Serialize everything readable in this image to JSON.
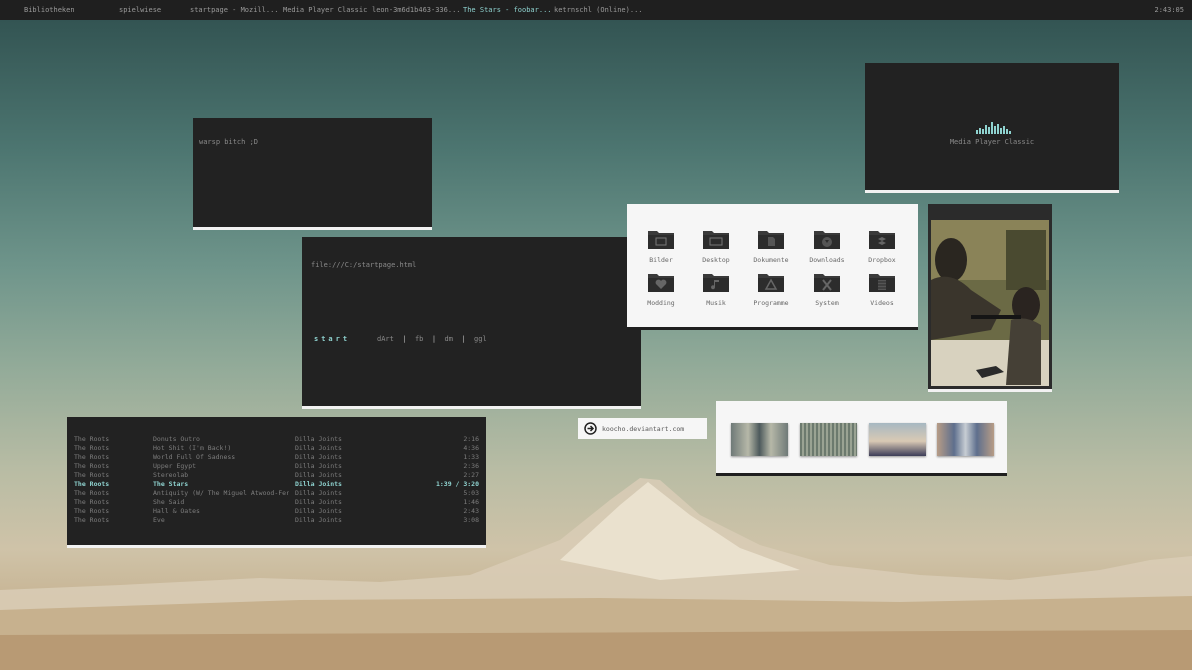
{
  "taskbar": {
    "items": [
      "Bibliotheken",
      "spielwiese",
      "startpage - Mozill...",
      "Media Player Classic",
      "leon-3m6d1b463-336...",
      "The Stars - foobar...",
      "ketrnschl (Online)..."
    ],
    "active_index": 5,
    "clock": "2:43:05"
  },
  "terminal": {
    "text": "warsp bitch ;D"
  },
  "mpc": {
    "label": "Media Player Classic"
  },
  "browser": {
    "url": "file:///C:/startpage.html",
    "start_label": "start",
    "links": [
      "dArt",
      "fb",
      "dm",
      "ggl"
    ],
    "separator": "|"
  },
  "folders": {
    "items": [
      {
        "label": "Bilder",
        "icon": "pictures-folder-icon"
      },
      {
        "label": "Desktop",
        "icon": "desktop-folder-icon"
      },
      {
        "label": "Dokumente",
        "icon": "documents-folder-icon"
      },
      {
        "label": "Downloads",
        "icon": "downloads-folder-icon"
      },
      {
        "label": "Dropbox",
        "icon": "dropbox-folder-icon"
      },
      {
        "label": "Modding",
        "icon": "heart-folder-icon"
      },
      {
        "label": "Musik",
        "icon": "music-folder-icon"
      },
      {
        "label": "Programme",
        "icon": "programs-folder-icon"
      },
      {
        "label": "System",
        "icon": "system-folder-icon"
      },
      {
        "label": "Videos",
        "icon": "videos-folder-icon"
      }
    ]
  },
  "playlist": {
    "rows": [
      {
        "artist": "The Roots",
        "title": "Donuts Outro",
        "album": "Dilla Joints",
        "time": "2:16",
        "playing": false
      },
      {
        "artist": "The Roots",
        "title": "Hot Shit (I'm Back!)",
        "album": "Dilla Joints",
        "time": "4:36",
        "playing": false
      },
      {
        "artist": "The Roots",
        "title": "World Full Of Sadness",
        "album": "Dilla Joints",
        "time": "1:33",
        "playing": false
      },
      {
        "artist": "The Roots",
        "title": "Upper Egypt",
        "album": "Dilla Joints",
        "time": "2:36",
        "playing": false
      },
      {
        "artist": "The Roots",
        "title": "Stereolab",
        "album": "Dilla Joints",
        "time": "2:27",
        "playing": false
      },
      {
        "artist": "The Roots",
        "title": "The Stars",
        "album": "Dilla Joints",
        "time": "1:39 / 3:20",
        "playing": true
      },
      {
        "artist": "The Roots",
        "title": "Antiquity (W/ The Miguel Atwood-Fer...",
        "album": "Dilla Joints",
        "time": "5:03",
        "playing": false
      },
      {
        "artist": "The Roots",
        "title": "She Said",
        "album": "Dilla Joints",
        "time": "1:46",
        "playing": false
      },
      {
        "artist": "The Roots",
        "title": "Hall & Oates",
        "album": "Dilla Joints",
        "time": "2:43",
        "playing": false
      },
      {
        "artist": "The Roots",
        "title": "Eve",
        "album": "Dilla Joints",
        "time": "3:08",
        "playing": false
      }
    ]
  },
  "deviantart": {
    "text": "koocho.deviantart.com",
    "icon": "arrow-circle-icon"
  },
  "colors": {
    "accent": "#8fd3d0",
    "panel_dark": "#222222",
    "panel_light": "#f6f6f6"
  }
}
